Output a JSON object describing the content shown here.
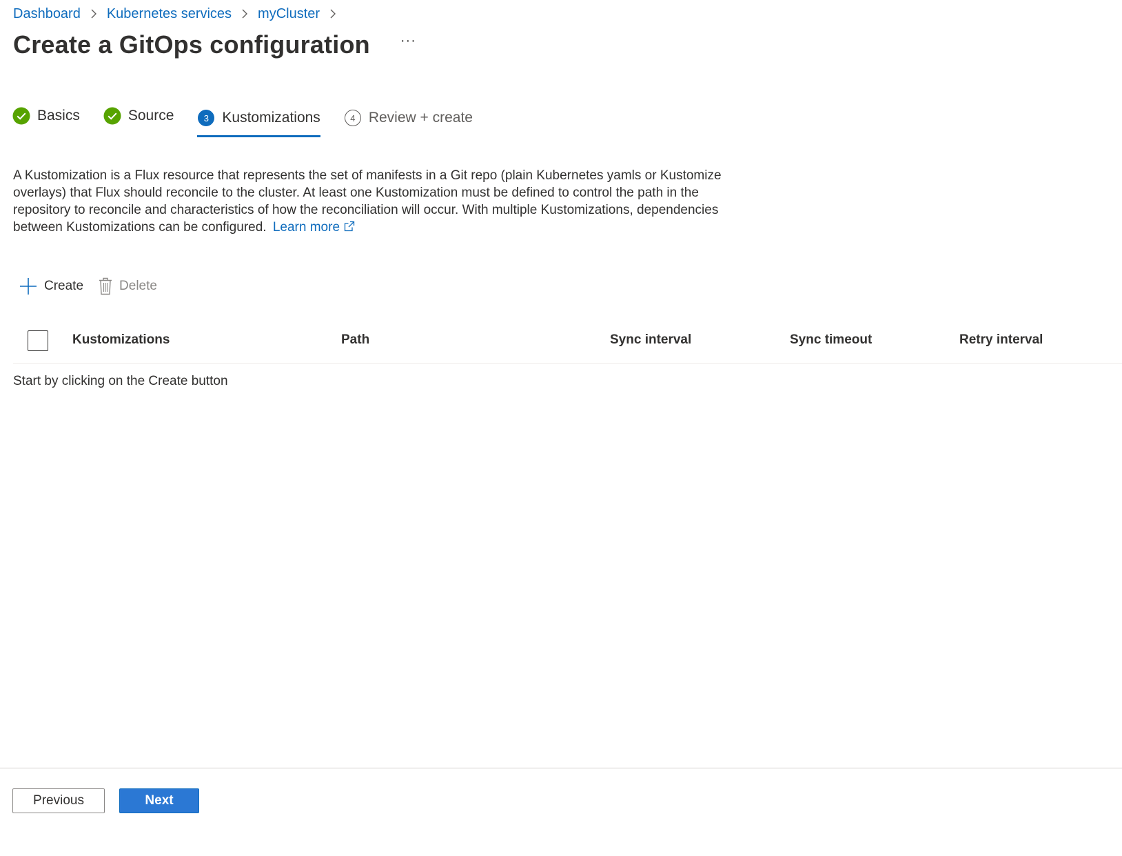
{
  "breadcrumb": {
    "items": [
      {
        "label": "Dashboard"
      },
      {
        "label": "Kubernetes services"
      },
      {
        "label": "myCluster"
      }
    ]
  },
  "page": {
    "title": "Create a GitOps configuration",
    "more_label": "···"
  },
  "wizard": {
    "tabs": [
      {
        "label": "Basics",
        "state": "done",
        "icon": "check-circle-icon"
      },
      {
        "label": "Source",
        "state": "done",
        "icon": "check-circle-icon"
      },
      {
        "label": "Kustomizations",
        "state": "active",
        "number": "3"
      },
      {
        "label": "Review + create",
        "state": "pending",
        "number": "4"
      }
    ]
  },
  "description": {
    "text": "A Kustomization is a Flux resource that represents the set of manifests in a Git repo (plain Kubernetes yamls or Kustomize overlays) that Flux should reconcile to the cluster. At least one Kustomization must be defined to control the path in the repository to reconcile and characteristics of how the reconciliation will occur. With multiple Kustomizations, dependencies between Kustomizations can be configured.",
    "learn_more": "Learn more"
  },
  "toolbar": {
    "create_label": "Create",
    "delete_label": "Delete"
  },
  "grid": {
    "columns": [
      {
        "label": "Kustomizations"
      },
      {
        "label": "Path"
      },
      {
        "label": "Sync interval"
      },
      {
        "label": "Sync timeout"
      },
      {
        "label": "Retry interval"
      }
    ],
    "empty_message": "Start by clicking on the Create button"
  },
  "footer": {
    "previous_label": "Previous",
    "next_label": "Next"
  },
  "colors": {
    "accent": "#0f6cbd",
    "success": "#57a300",
    "primary_button": "#2b78d4"
  }
}
